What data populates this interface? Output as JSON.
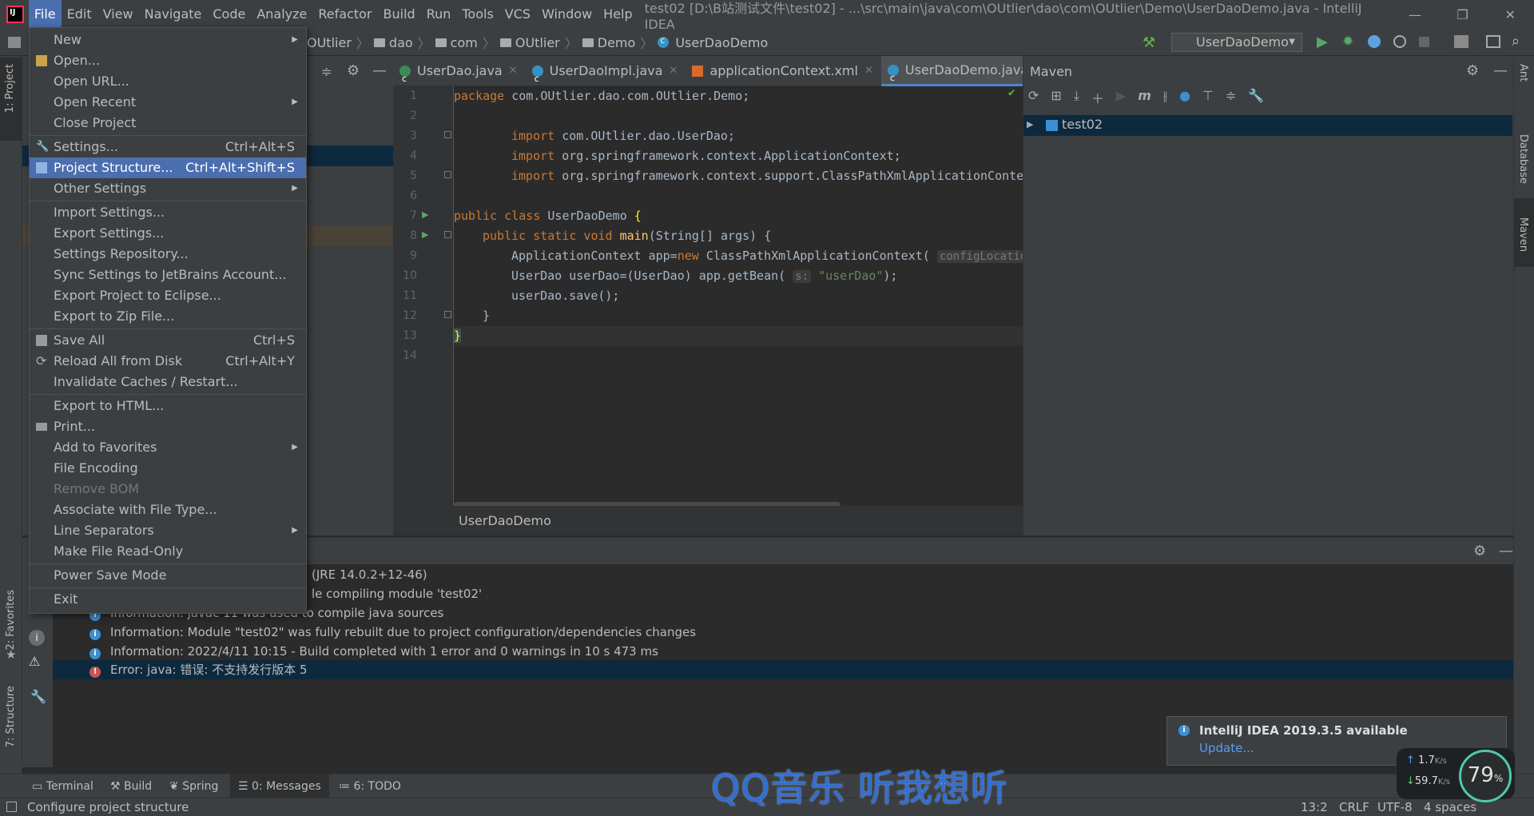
{
  "menubar": {
    "items": [
      "File",
      "Edit",
      "View",
      "Navigate",
      "Code",
      "Analyze",
      "Refactor",
      "Build",
      "Run",
      "Tools",
      "VCS",
      "Window",
      "Help"
    ],
    "window_title": "test02 [D:\\B站测试文件\\test02] - ...\\src\\main\\java\\com\\OUtlier\\dao\\com\\OUtlier\\Demo\\UserDaoDemo.java - IntelliJ IDEA"
  },
  "breadcrumb": [
    "OUtlier",
    "dao",
    "com",
    "OUtlier",
    "Demo",
    "UserDaoDemo"
  ],
  "run_config": "UserDaoDemo",
  "file_menu": {
    "items": [
      {
        "label": "New",
        "shortcut": "",
        "submenu": true
      },
      {
        "label": "Open...",
        "shortcut": ""
      },
      {
        "label": "Open URL...",
        "shortcut": ""
      },
      {
        "label": "Open Recent",
        "shortcut": "",
        "submenu": true
      },
      {
        "label": "Close Project",
        "shortcut": ""
      },
      {
        "label": "Settings...",
        "shortcut": "Ctrl+Alt+S"
      },
      {
        "label": "Project Structure...",
        "shortcut": "Ctrl+Alt+Shift+S",
        "selected": true
      },
      {
        "label": "Other Settings",
        "shortcut": "",
        "submenu": true
      },
      {
        "label": "Import Settings...",
        "shortcut": ""
      },
      {
        "label": "Export Settings...",
        "shortcut": ""
      },
      {
        "label": "Settings Repository...",
        "shortcut": ""
      },
      {
        "label": "Sync Settings to JetBrains Account...",
        "shortcut": ""
      },
      {
        "label": "Export Project to Eclipse...",
        "shortcut": ""
      },
      {
        "label": "Export to Zip File...",
        "shortcut": ""
      },
      {
        "label": "Save All",
        "shortcut": "Ctrl+S"
      },
      {
        "label": "Reload All from Disk",
        "shortcut": "Ctrl+Alt+Y"
      },
      {
        "label": "Invalidate Caches / Restart...",
        "shortcut": ""
      },
      {
        "label": "Export to HTML...",
        "shortcut": ""
      },
      {
        "label": "Print...",
        "shortcut": ""
      },
      {
        "label": "Add to Favorites",
        "shortcut": "",
        "submenu": true
      },
      {
        "label": "File Encoding",
        "shortcut": ""
      },
      {
        "label": "Remove BOM",
        "shortcut": "",
        "disabled": true
      },
      {
        "label": "Associate with File Type...",
        "shortcut": ""
      },
      {
        "label": "Line Separators",
        "shortcut": "",
        "submenu": true
      },
      {
        "label": "Make File Read-Only",
        "shortcut": ""
      },
      {
        "label": "Power Save Mode",
        "shortcut": ""
      },
      {
        "label": "Exit",
        "shortcut": ""
      }
    ]
  },
  "editor": {
    "tabs": [
      "UserDao.java",
      "UserDaoImpl.java",
      "applicationContext.xml",
      "UserDaoDemo.java"
    ],
    "tab_overflow": "2",
    "line_numbers": [
      "1",
      "2",
      "3",
      "4",
      "5",
      "6",
      "7",
      "8",
      "9",
      "10",
      "11",
      "12",
      "13",
      "14"
    ],
    "footer": "UserDaoDemo"
  },
  "maven": {
    "title": "Maven",
    "project": "test02"
  },
  "messages": [
    {
      "type": "text",
      "text": "(JRE 14.0.2+12-46)"
    },
    {
      "type": "text",
      "text": "le compiling module 'test02'"
    },
    {
      "type": "info",
      "text": "Information: javac 11 was used to compile java sources"
    },
    {
      "type": "info",
      "text": "Information: Module \"test02\" was fully rebuilt due to project configuration/dependencies changes"
    },
    {
      "type": "info",
      "text": "Information: 2022/4/11 10:15 - Build completed with 1 error and 0 warnings in 10 s 473 ms"
    },
    {
      "type": "error",
      "text": "Error: java: 错误: 不支持发行版本 5"
    }
  ],
  "left_stripe": {
    "project": "1: Project",
    "favorites": "2: Favorites",
    "structure": "7: Structure"
  },
  "right_stripe": {
    "ant": "Ant",
    "database": "Database",
    "maven": "Maven"
  },
  "bottom_tabs": [
    "Terminal",
    "Build",
    "Spring",
    "0: Messages",
    "6: TODO"
  ],
  "notification": {
    "title": "IntelliJ IDEA 2019.3.5 available",
    "link": "Update..."
  },
  "status": {
    "text": "Configure project structure",
    "position": "13:2",
    "line_sep": "CRLF",
    "encoding": "UTF-8",
    "indent": "4 spaces"
  },
  "overlay": {
    "watermark": "QQ音乐 听我想听",
    "up_speed": "1.7",
    "down_speed": "59.7",
    "unit": "K/s",
    "cpu": "79",
    "cpu_unit": "%"
  }
}
